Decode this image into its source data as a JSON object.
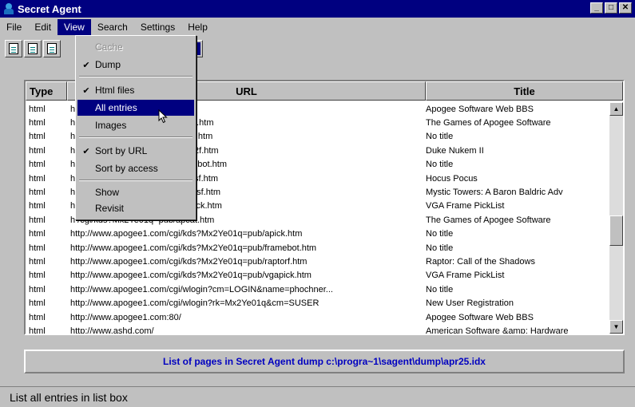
{
  "window": {
    "title": "Secret Agent"
  },
  "menubar": [
    "File",
    "Edit",
    "View",
    "Search",
    "Settings",
    "Help"
  ],
  "view_menu": {
    "items": [
      {
        "label": "Cache",
        "checked": false,
        "disabled": true
      },
      {
        "label": "Dump",
        "checked": true,
        "disabled": false
      },
      {
        "label": "Html files",
        "checked": true,
        "disabled": false
      },
      {
        "label": "All entries",
        "checked": false,
        "disabled": false,
        "highlighted": true
      },
      {
        "label": "Images",
        "checked": false,
        "disabled": false
      },
      {
        "label": "Sort by URL",
        "checked": true,
        "disabled": false
      },
      {
        "label": "Sort by access",
        "checked": false,
        "disabled": false
      },
      {
        "label": "Show",
        "checked": false,
        "disabled": false
      },
      {
        "label": "Revisit",
        "checked": false,
        "disabled": false
      }
    ]
  },
  "list": {
    "columns": [
      "Type",
      "URL",
      "Title"
    ],
    "rows": [
      {
        "type": "html",
        "url": "h            /",
        "title": "Apogee Software Web BBS"
      },
      {
        "type": "html",
        "url": "h            /cgi/kds?bLpPs00P=pub/apcat.htm",
        "title": "The Games of Apogee Software"
      },
      {
        "type": "html",
        "url": "h            /cgi/kds?bLpPs00P=pub/apick.htm",
        "title": "No title"
      },
      {
        "type": "html",
        "url": "h            /cgi/kds?bLpPs00P=pub/duke2f.htm",
        "title": "Duke Nukem II"
      },
      {
        "type": "html",
        "url": "h            /cgi/kds?bLpPs00P=pub/framebot.htm",
        "title": "No title"
      },
      {
        "type": "html",
        "url": "h            /cgi/kds?bLpPs00P=pub/hocusf.htm",
        "title": "Hocus Pocus"
      },
      {
        "type": "html",
        "url": "h            /cgi/kds?bLpPs00P=pub/towersf.htm",
        "title": "Mystic Towers: A Baron Baldric Adv"
      },
      {
        "type": "html",
        "url": "h            /cgi/kds?bLpPs00P=pub/vgapick.htm",
        "title": "VGA Frame PickList"
      },
      {
        "type": "html",
        "url": "h            /cgi/kds?Mx2Ye01q=pub/apcat.htm",
        "title": "The Games of Apogee Software"
      },
      {
        "type": "html",
        "url": "http://www.apogee1.com/cgi/kds?Mx2Ye01q=pub/apick.htm",
        "title": "No title"
      },
      {
        "type": "html",
        "url": "http://www.apogee1.com/cgi/kds?Mx2Ye01q=pub/framebot.htm",
        "title": "No title"
      },
      {
        "type": "html",
        "url": "http://www.apogee1.com/cgi/kds?Mx2Ye01q=pub/raptorf.htm",
        "title": "Raptor: Call of the Shadows"
      },
      {
        "type": "html",
        "url": "http://www.apogee1.com/cgi/kds?Mx2Ye01q=pub/vgapick.htm",
        "title": "VGA Frame PickList"
      },
      {
        "type": "html",
        "url": "http://www.apogee1.com/cgi/wlogin?cm=LOGIN&name=phochner...",
        "title": "No title"
      },
      {
        "type": "html",
        "url": "http://www.apogee1.com/cgi/wlogin?rk=Mx2Ye01q&cm=SUSER",
        "title": "New User Registration"
      },
      {
        "type": "html",
        "url": "http://www.apogee1.com:80/",
        "title": "Apogee Software Web BBS"
      },
      {
        "type": "html",
        "url": "http://www.ashd.com/",
        "title": "American Software &amp; Hardware"
      }
    ]
  },
  "caption": "List of pages in Secret Agent dump c:\\progra~1\\sagent\\dump\\apr25.idx",
  "status": "List all entries in list box"
}
